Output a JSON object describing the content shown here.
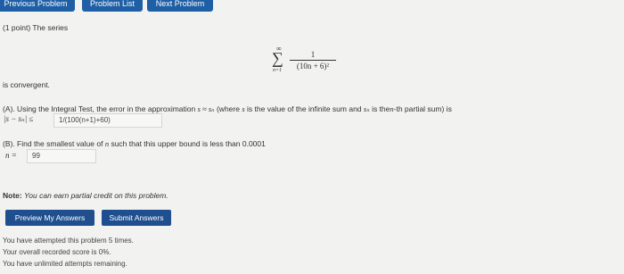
{
  "nav": {
    "previous": "Previous Problem",
    "list": "Problem List",
    "next": "Next Problem"
  },
  "problem": {
    "points": "(1 point) The series",
    "series": {
      "sigma": "∑",
      "upper": "∞",
      "lower": "n=1",
      "numerator": "1",
      "denominator": "(10n + 6)²"
    },
    "convergent": "is convergent.",
    "partA": {
      "text_1": "(A). Using the Integral Test, the error in the approximation",
      "approx_expr": "s ≈ sₙ",
      "text_2": "(where",
      "s_var": "s",
      "text_3": "is the value of the infinite sum and",
      "sn_var": "sₙ",
      "text_4": "is the",
      "n_var": "n",
      "text_5": "-th partial sum) is",
      "error_expr": "|s − sₙ| ≤",
      "answer": "1/(100(n+1)+60)"
    },
    "partB": {
      "text_1": "(B). Find the smallest value of",
      "n_var": "n",
      "text_2": "such that this upper bound is less than 0.0001",
      "n_eq": "n =",
      "answer": "99"
    }
  },
  "note": {
    "label": "Note:",
    "text": "You can earn partial credit on this problem."
  },
  "buttons": {
    "preview": "Preview My Answers",
    "submit": "Submit Answers"
  },
  "status": {
    "attempts": "You have attempted this problem 5 times.",
    "score": "Your overall recorded score is 0%.",
    "remaining": "You have unlimited attempts remaining."
  }
}
